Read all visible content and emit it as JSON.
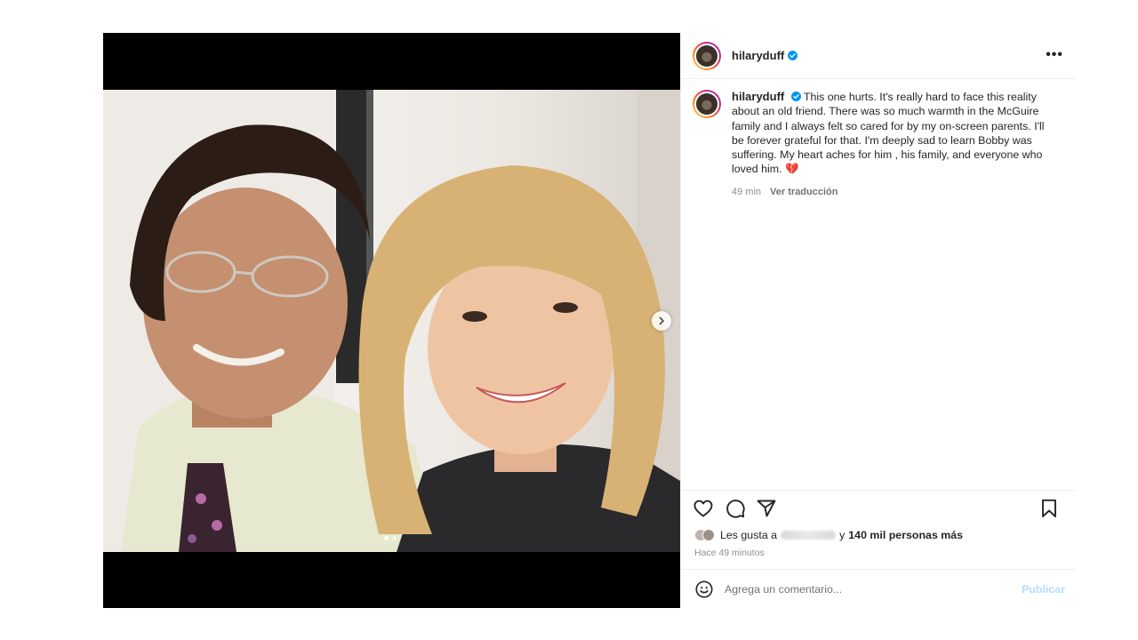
{
  "post": {
    "username": "hilaryduff",
    "verified": true,
    "caption": "This one hurts. It's really hard to face this reality about an old friend. There was so much warmth in the McGuire family and I always felt so cared for by my on-screen parents. I'll be forever grateful for that. I'm deeply sad to learn Bobby was suffering. My heart aches for him , his family, and everyone who loved him.",
    "caption_emoji": "💔",
    "caption_time": "49 min",
    "translate_label": "Ver traducción",
    "likes_prefix": "Les gusta a",
    "likes_connector": "y",
    "likes_count": "140 mil personas más",
    "posted_ago": "Hace 49 minutos",
    "comment_placeholder": "Agrega un comentario...",
    "publish_label": "Publicar",
    "more_label": "•••",
    "carousel": {
      "total": 2,
      "current": 1
    }
  },
  "icons": {
    "like": "heart-outline-icon",
    "comment": "comment-bubble-icon",
    "share": "paper-plane-icon",
    "save": "bookmark-icon",
    "emoji": "smiley-icon",
    "next": "chevron-right-icon",
    "verified": "verified-badge-icon"
  },
  "colors": {
    "verified_blue": "#0095f6",
    "publish_disabled": "#b2dffc",
    "broken_heart": "#e0245e"
  }
}
